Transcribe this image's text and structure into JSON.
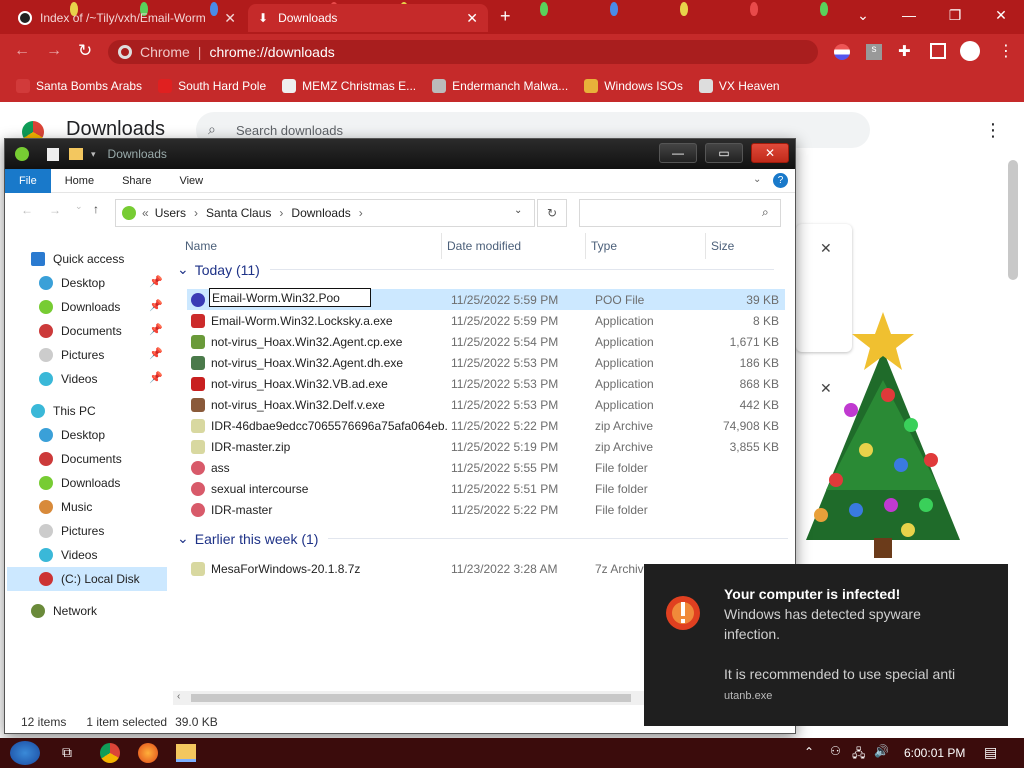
{
  "browser": {
    "tabs": [
      {
        "title": "Index of /~Tily/vxh/Email-Worm",
        "active": false
      },
      {
        "title": "Downloads",
        "active": true
      }
    ],
    "omnibox": {
      "site": "Chrome",
      "url": "chrome://downloads"
    },
    "bookmarks": [
      {
        "label": "Santa Bombs Arabs",
        "color": "#d13a3a"
      },
      {
        "label": "South Hard Pole",
        "color": "#e02020"
      },
      {
        "label": "MEMZ Christmas E...",
        "color": "#eeeeee"
      },
      {
        "label": "Endermanch Malwa...",
        "color": "#bbbbbb"
      },
      {
        "label": "Windows ISOs",
        "color": "#e8b23a"
      },
      {
        "label": "VX Heaven",
        "color": "#dddddd"
      }
    ]
  },
  "downloads_page": {
    "title": "Downloads",
    "search_placeholder": "Search downloads"
  },
  "explorer": {
    "title": "Downloads",
    "ribbon": [
      "File",
      "Home",
      "Share",
      "View"
    ],
    "breadcrumb": [
      "Users",
      "Santa Claus",
      "Downloads"
    ],
    "columns": {
      "name": "Name",
      "date": "Date modified",
      "type": "Type",
      "size": "Size"
    },
    "nav": {
      "quick_access": "Quick access",
      "quick_items": [
        "Desktop",
        "Downloads",
        "Documents",
        "Pictures",
        "Videos"
      ],
      "this_pc": "This PC",
      "pc_items": [
        "Desktop",
        "Documents",
        "Downloads",
        "Music",
        "Pictures",
        "Videos",
        "(C:) Local Disk"
      ],
      "network": "Network"
    },
    "groups": [
      {
        "label": "Today (11)",
        "files": [
          {
            "name": "Email-Worm.Win32.Poo",
            "date": "11/25/2022 5:59 PM",
            "type": "POO File",
            "size": "39 KB",
            "icon_color": "#3b3bb5",
            "icon": "worm-icon",
            "renaming": true
          },
          {
            "name": "Email-Worm.Win32.Locksky.a.exe",
            "date": "11/25/2022 5:59 PM",
            "type": "Application",
            "size": "8 KB",
            "icon_color": "#cc2b2b",
            "icon": "app-icon"
          },
          {
            "name": "not-virus_Hoax.Win32.Agent.cp.exe",
            "date": "11/25/2022 5:54 PM",
            "type": "Application",
            "size": "1,671 KB",
            "icon_color": "#6a9a3a",
            "icon": "app-icon"
          },
          {
            "name": "not-virus_Hoax.Win32.Agent.dh.exe",
            "date": "11/25/2022 5:53 PM",
            "type": "Application",
            "size": "186 KB",
            "icon_color": "#4a7a4a",
            "icon": "app-icon"
          },
          {
            "name": "not-virus_Hoax.Win32.VB.ad.exe",
            "date": "11/25/2022 5:53 PM",
            "type": "Application",
            "size": "868 KB",
            "icon_color": "#c82020",
            "icon": "x-icon"
          },
          {
            "name": "not-virus_Hoax.Win32.Delf.v.exe",
            "date": "11/25/2022 5:53 PM",
            "type": "Application",
            "size": "442 KB",
            "icon_color": "#8a5a3a",
            "icon": "app-icon"
          },
          {
            "name": "IDR-46dbae9edcc7065576696a75afa064eb...",
            "date": "11/25/2022 5:22 PM",
            "type": "zip Archive",
            "size": "74,908 KB",
            "icon_color": "#d8d8a0",
            "icon": "zip-icon"
          },
          {
            "name": "IDR-master.zip",
            "date": "11/25/2022 5:19 PM",
            "type": "zip Archive",
            "size": "3,855 KB",
            "icon_color": "#d8d8a0",
            "icon": "zip-icon"
          },
          {
            "name": "ass",
            "date": "11/25/2022 5:55 PM",
            "type": "File folder",
            "size": "",
            "icon_color": "#d85a6a",
            "icon": "folder-icon"
          },
          {
            "name": "sexual intercourse",
            "date": "11/25/2022 5:51 PM",
            "type": "File folder",
            "size": "",
            "icon_color": "#d85a6a",
            "icon": "folder-icon"
          },
          {
            "name": "IDR-master",
            "date": "11/25/2022 5:22 PM",
            "type": "File folder",
            "size": "",
            "icon_color": "#d85a6a",
            "icon": "folder-icon"
          }
        ]
      },
      {
        "label": "Earlier this week (1)",
        "files": [
          {
            "name": "MesaForWindows-20.1.8.7z",
            "date": "11/23/2022 3:28 AM",
            "type": "7z Archive",
            "size": "",
            "icon_color": "#d8d8a0",
            "icon": "zip-icon"
          }
        ]
      }
    ],
    "status": {
      "count": "12 items",
      "selected": "1 item selected",
      "size": "39.0 KB"
    }
  },
  "toast": {
    "title": "Your computer is infected!",
    "line1": "Windows has detected spyware",
    "line2": "infection.",
    "line3": "It is recommended to use special anti",
    "source": "utanb.exe"
  },
  "taskbar": {
    "clock": "6:00:01 PM"
  }
}
